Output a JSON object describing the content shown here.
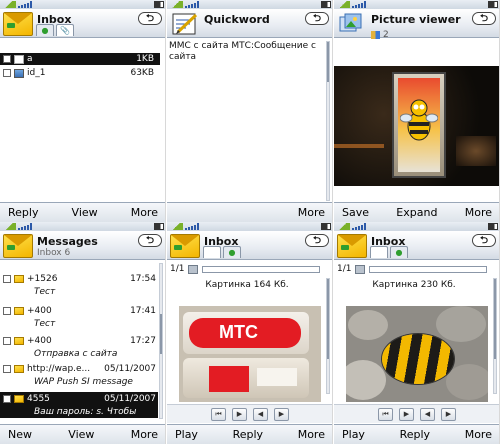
{
  "panels": {
    "inbox1": {
      "title": "Inbox",
      "back": "⮌",
      "tabs": [
        "●",
        "📎"
      ],
      "items": [
        {
          "name": "a",
          "size": "1KB"
        },
        {
          "name": "id_1",
          "size": "63KB"
        }
      ],
      "softkeys": [
        "Reply",
        "View",
        "More"
      ]
    },
    "quickword": {
      "title": "Quickword",
      "back": "⮌",
      "body": "ММС с сайта МТС:Сообщение с сайта",
      "softkeys": [
        "",
        "",
        "More"
      ]
    },
    "picture": {
      "title": "Picture viewer",
      "back": "⮌",
      "count": "2",
      "softkeys": [
        "Save",
        "Expand",
        "More"
      ]
    },
    "messages": {
      "title": "Messages",
      "back": "⮌",
      "subtitle": "Inbox 6",
      "items": [
        {
          "from": "+1526",
          "time": "17:54",
          "text": "Тест"
        },
        {
          "from": "+400",
          "time": "17:41",
          "text": "Тест"
        },
        {
          "from": "+400",
          "time": "17:27",
          "text": "Отправка с сайта"
        },
        {
          "from": "http://wap.e...",
          "time": "05/11/2007",
          "text": "WAP Push SI message"
        },
        {
          "from": "4555",
          "time": "05/11/2007",
          "text": "Ваш пароль: s. Чтобы см..."
        }
      ],
      "softkeys": [
        "New",
        "View",
        "More"
      ]
    },
    "inbox2": {
      "title": "Inbox",
      "back": "⮌",
      "page": "1/1",
      "caption": "Картинка 164 Кб.",
      "softkeys": [
        "Play",
        "Reply",
        "More"
      ]
    },
    "inbox3": {
      "title": "Inbox",
      "back": "⮌",
      "page": "1/1",
      "caption": "Картинка 230 Кб.",
      "softkeys": [
        "Play",
        "Reply",
        "More"
      ]
    }
  },
  "player": [
    "⏮",
    "▶",
    "◀",
    "▶"
  ],
  "photo_text": {
    "mts": "МТС"
  },
  "colors": {
    "accent": "#2c59a8",
    "selection": "#111111",
    "envelope": "#f3b500",
    "softbar": "#dde3ea"
  }
}
